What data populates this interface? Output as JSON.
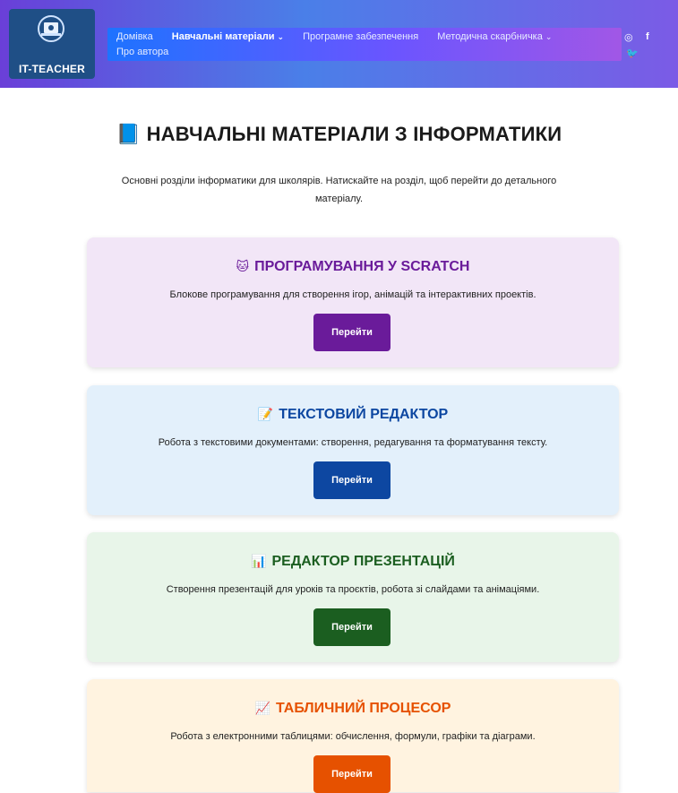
{
  "brand": {
    "logo_text": "IT-TEACHER"
  },
  "nav": {
    "items": [
      {
        "label": "Домівка"
      },
      {
        "label": "Навчальні матеріали"
      },
      {
        "label": "Програмне забезпечення"
      },
      {
        "label": "Методична скарбничка"
      },
      {
        "label": "Про автора"
      }
    ],
    "chevron": "⌄"
  },
  "social": {
    "instagram": "◎",
    "facebook": "f",
    "twitter": "🐦"
  },
  "page": {
    "title_icon": "📘",
    "title": "НАВЧАЛЬНІ МАТЕРІАЛИ З ІНФОРМАТИКИ",
    "intro": "Основні розділи інформатики для школярів. Натискайте на розділ, щоб перейти до детального матеріалу."
  },
  "cards": [
    {
      "icon": "🐱",
      "title": "ПРОГРАМУВАННЯ У SCRATCH",
      "description": "Блокове програмування для створення ігор, анімацій та інтерактивних проектів.",
      "button": "Перейти",
      "bg": "#f2e6f7",
      "title_color": "#6a1b9a",
      "button_color": "#6a1b9a"
    },
    {
      "icon": "📝",
      "title": "ТЕКСТОВИЙ РЕДАКТОР",
      "description": "Робота з текстовими документами: створення, редагування та форматування тексту.",
      "button": "Перейти",
      "bg": "#e3f0fb",
      "title_color": "#0d47a1",
      "button_color": "#0d47a1"
    },
    {
      "icon": "📊",
      "title": "РЕДАКТОР ПРЕЗЕНТАЦІЙ",
      "description": "Створення презентацій для уроків та проєктів, робота зі слайдами та анімаціями.",
      "button": "Перейти",
      "bg": "#e8f5e9",
      "title_color": "#1b5e20",
      "button_color": "#1b5e20"
    },
    {
      "icon": "📈",
      "title": "ТАБЛИЧНИЙ ПРОЦЕСОР",
      "description": "Робота з електронними таблицями: обчислення, формули, графіки та діаграми.",
      "button": "Перейти",
      "bg": "#fff3e0",
      "title_color": "#e65100",
      "button_color": "#e65100"
    }
  ]
}
